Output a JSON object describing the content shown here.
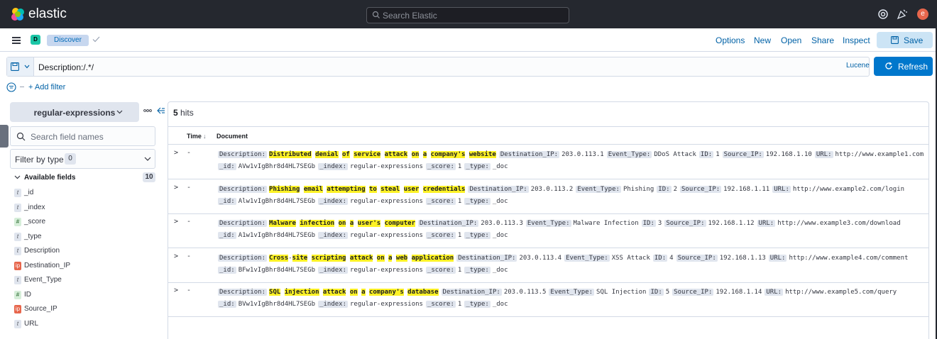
{
  "header": {
    "brand": "elastic",
    "search_placeholder": "Search Elastic",
    "avatar_letter": "e"
  },
  "appbar": {
    "app_badge": "D",
    "breadcrumb": "Discover",
    "menu": [
      "Options",
      "New",
      "Open",
      "Share",
      "Inspect"
    ],
    "save_label": "Save"
  },
  "query": {
    "text": "Description:/.*/",
    "language": "Lucene",
    "refresh_label": "Refresh",
    "add_filter": "+ Add filter"
  },
  "sidebar": {
    "index_pattern": "regular-expressions",
    "search_placeholder": "Search field names",
    "filter_by_type": "Filter by type",
    "filter_count": "0",
    "available_fields_label": "Available fields",
    "available_count": "10",
    "fields": [
      {
        "name": "_id",
        "type": "t"
      },
      {
        "name": "_index",
        "type": "t"
      },
      {
        "name": "_score",
        "type": "#"
      },
      {
        "name": "_type",
        "type": "t"
      },
      {
        "name": "Description",
        "type": "t"
      },
      {
        "name": "Destination_IP",
        "type": "ip"
      },
      {
        "name": "Event_Type",
        "type": "t"
      },
      {
        "name": "ID",
        "type": "#"
      },
      {
        "name": "Source_IP",
        "type": "ip"
      },
      {
        "name": "URL",
        "type": "t"
      }
    ]
  },
  "results": {
    "hits_count": "5",
    "hits_label": " hits",
    "col_time": "Time",
    "col_document": "Document",
    "rows": [
      {
        "time": "-",
        "desc": [
          "Distributed",
          " ",
          "denial",
          " ",
          "of",
          " ",
          "service",
          " ",
          "attack",
          " ",
          "on",
          " ",
          "a",
          " ",
          "company's",
          " ",
          "website"
        ],
        "dest_ip": "203.0.113.1",
        "event_type": "DDoS Attack",
        "id": "1",
        "source_ip": "192.168.1.10",
        "url": "http://www.example1.com",
        "_id": "AVw1vIgBhr8d4HL7SEGb",
        "_index": "regular-expressions",
        "_score": "1",
        "_type": "_doc"
      },
      {
        "time": "-",
        "desc": [
          "Phishing",
          " ",
          "email",
          " ",
          "attempting",
          " ",
          "to",
          " ",
          "steal",
          " ",
          "user",
          " ",
          "credentials"
        ],
        "dest_ip": "203.0.113.2",
        "event_type": "Phishing",
        "id": "2",
        "source_ip": "192.168.1.11",
        "url": "http://www.example2.com/login",
        "_id": "Alw1vIgBhr8d4HL7SEGb",
        "_index": "regular-expressions",
        "_score": "1",
        "_type": "_doc"
      },
      {
        "time": "-",
        "desc": [
          "Malware",
          " ",
          "infection",
          " ",
          "on",
          " ",
          "a",
          " ",
          "user's",
          " ",
          "computer"
        ],
        "dest_ip": "203.0.113.3",
        "event_type": "Malware Infection",
        "id": "3",
        "source_ip": "192.168.1.12",
        "url": "http://www.example3.com/download",
        "_id": "A1w1vIgBhr8d4HL7SEGb",
        "_index": "regular-expressions",
        "_score": "1",
        "_type": "_doc"
      },
      {
        "time": "-",
        "desc": [
          "Cross",
          "-",
          "site",
          " ",
          "scripting",
          " ",
          "attack",
          " ",
          "on",
          " ",
          "a",
          " ",
          "web",
          " ",
          "application"
        ],
        "dest_ip": "203.0.113.4",
        "event_type": "XSS Attack",
        "id": "4",
        "source_ip": "192.168.1.13",
        "url": "http://www.example4.com/comment",
        "_id": "BFw1vIgBhr8d4HL7SEGb",
        "_index": "regular-expressions",
        "_score": "1",
        "_type": "_doc"
      },
      {
        "time": "-",
        "desc": [
          "SQL",
          " ",
          "injection",
          " ",
          "attack",
          " ",
          "on",
          " ",
          "a",
          " ",
          "company's",
          " ",
          "database"
        ],
        "dest_ip": "203.0.113.5",
        "event_type": "SQL Injection",
        "id": "5",
        "source_ip": "192.168.1.14",
        "url": "http://www.example5.com/query",
        "_id": "BVw1vIgBhr8d4HL7SEGb",
        "_index": "regular-expressions",
        "_score": "1",
        "_type": "_doc"
      }
    ]
  },
  "field_keys": {
    "description": "Description:",
    "dest_ip": "Destination_IP:",
    "event_type": "Event_Type:",
    "id": "ID:",
    "source_ip": "Source_IP:",
    "url": "URL:",
    "_id": "_id:",
    "_index": "_index:",
    "_score": "_score:",
    "_type": "_type:"
  }
}
